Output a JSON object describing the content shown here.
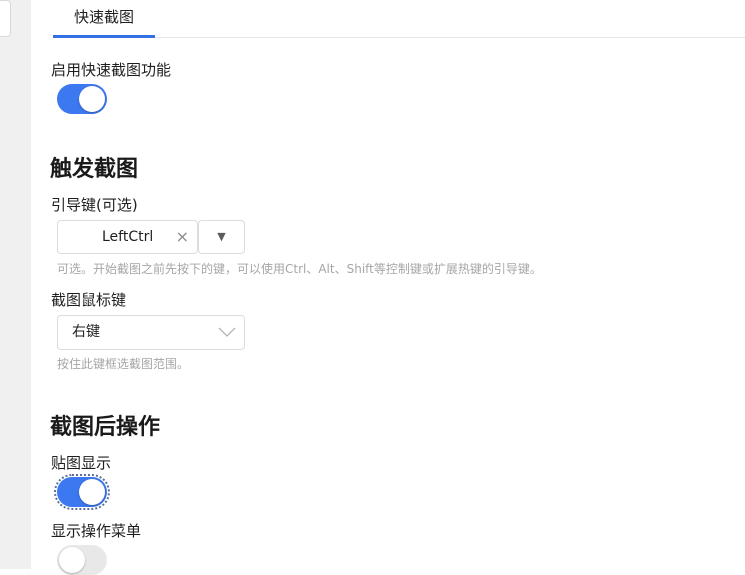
{
  "tabs": [
    {
      "label": "快速截图",
      "active": true
    }
  ],
  "enable_section": {
    "label": "启用快速截图功能",
    "toggle_on": true
  },
  "trigger_section": {
    "heading": "触发截图",
    "lead_key": {
      "label": "引导键(可选)",
      "value": "LeftCtrl",
      "clear_glyph": "×",
      "dropdown_glyph": "▼",
      "hint": "可选。开始截图之前先按下的键，可以使用Ctrl、Alt、Shift等控制键或扩展热键的引导键。"
    },
    "mouse_key": {
      "label": "截图鼠标键",
      "selected": "右键",
      "hint": "按住此键框选截图范围。"
    }
  },
  "after_section": {
    "heading": "截图后操作",
    "pin_display": {
      "label": "贴图显示",
      "toggle_on": true
    },
    "show_menu": {
      "label": "显示操作菜单",
      "toggle_on": false
    }
  },
  "colors": {
    "accent": "#3370e6",
    "toggle_on": "#3c78f0",
    "toggle_off": "#e8e8e8",
    "hint_text": "#a6a6a6"
  }
}
